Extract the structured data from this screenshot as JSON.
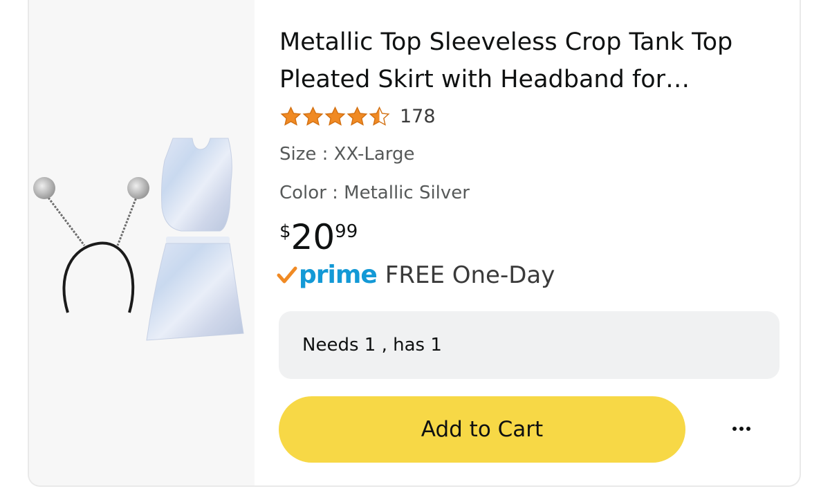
{
  "product": {
    "title": "Metallic Top Sleeveless Crop Tank Top Pleated Skirt with Headband for…",
    "rating": 4.5,
    "rating_count": "178",
    "size_label": "Size : XX-Large",
    "color_label": "Color : Metallic Silver",
    "price": {
      "symbol": "$",
      "whole": "20",
      "fraction": "99"
    },
    "prime_logo": "prime",
    "delivery": "FREE One-Day",
    "stock_status": "Needs 1 , has 1",
    "add_to_cart_label": "Add to Cart",
    "star_color": "#f08a24",
    "button_color": "#f7d846",
    "prime_color": "#1399d6"
  },
  "icons": {
    "prime_check": "check-icon",
    "more": "more-icon",
    "star": "star-icon"
  }
}
